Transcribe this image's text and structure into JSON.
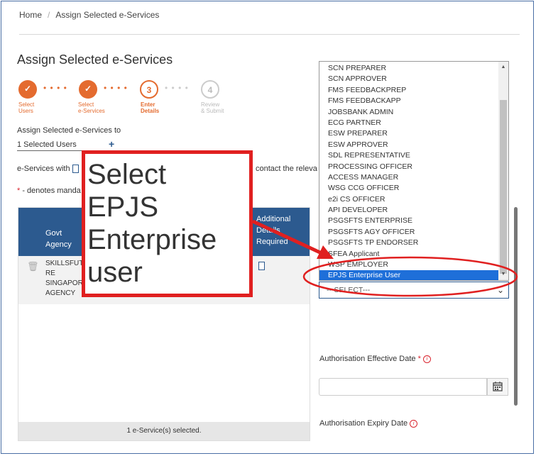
{
  "breadcrumb": {
    "home": "Home",
    "sep": "/",
    "current": "Assign Selected e-Services"
  },
  "page_title": "Assign Selected e-Services",
  "steps": [
    {
      "num": "✓",
      "label1": "Select",
      "label2": "Users",
      "state": "done"
    },
    {
      "num": "✓",
      "label1": "Select",
      "label2": "e-Services",
      "state": "done"
    },
    {
      "num": "3",
      "label1": "Enter",
      "label2": "Details",
      "state": "current"
    },
    {
      "num": "4",
      "label1": "Review",
      "label2": "& Submit",
      "state": "todo"
    }
  ],
  "assign_to_label": "Assign Selected e-Services to",
  "selected_users": "1 Selected Users",
  "plus": "+",
  "info_line_left": "e-Services with",
  "info_line_right": "contact the releva",
  "mandatory_star": "*",
  "mandatory_text": " - denotes manda",
  "table": {
    "headers": {
      "govt_agency_1": "Govt",
      "govt_agency_2": "Agency",
      "additional_1": "Additional",
      "additional_2": "Details",
      "additional_3": "Required"
    },
    "row": {
      "agency_1": "SKILLSFUT",
      "agency_2": "RE",
      "agency_3": "SINGAPOR",
      "agency_4": "AGENCY"
    },
    "footer": "1 e-Service(s) selected."
  },
  "callout": {
    "line1": "Select",
    "line2": "EPJS",
    "line3": "Enterprise",
    "line4": "user"
  },
  "dropdown": {
    "options": [
      "SCN PREPARER",
      "SCN APPROVER",
      "FMS FEEDBACKPREP",
      "FMS FEEDBACKAPP",
      "JOBSBANK ADMIN",
      "ECG PARTNER",
      "ESW PREPARER",
      "ESW APPROVER",
      "SDL REPRESENTATIVE",
      "PROCESSING OFFICER",
      "ACCESS MANAGER",
      "WSG CCG OFFICER",
      "e2i CS OFFICER",
      "API DEVELOPER",
      "PSGSFTS ENTERPRISE",
      "PSGSFTS AGY OFFICER",
      "PSGSFTS TP ENDORSER",
      "SFEA Applicant",
      "WSP EMPLOYER",
      "EPJS Enterprise User"
    ],
    "selected": "EPJS Enterprise User",
    "placeholder": "---SELECT---"
  },
  "auth_effective_label": "Authorisation Effective Date",
  "auth_expiry_label": "Authorisation Expiry Date",
  "info_glyph": "i",
  "required_star": "*",
  "colors": {
    "accent": "#e46b2f",
    "header_blue": "#2c5a8f",
    "highlight": "#1e6fd9",
    "annotation_red": "#e02020"
  }
}
